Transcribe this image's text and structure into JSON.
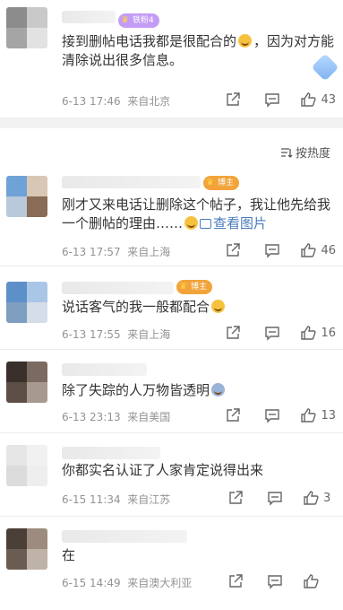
{
  "sort": {
    "label": "按热度"
  },
  "comments": [
    {
      "badge": "铁粉4",
      "text_a": "接到删帖电话我都是很配合的",
      "text_b": "，因为对方能清除说出很多信息。",
      "time": "6-13 17:46",
      "location": "来自北京",
      "likes": "43"
    },
    {
      "badge": "博主",
      "text_a": "刚才又来电话让删除这个帖子，我让他先给我一个删帖的理由……",
      "link": "查看图片",
      "time": "6-13 17:57",
      "location": "来自上海",
      "likes": "46"
    },
    {
      "badge": "博主",
      "text_a": "说话客气的我一般都配合",
      "time": "6-13 17:55",
      "location": "来自上海",
      "likes": "16"
    },
    {
      "text_a": "除了失踪的人万物皆透明",
      "time": "6-13 23:13",
      "location": "来自美国",
      "likes": "13"
    },
    {
      "text_a": "你都实名认证了人家肯定说得出来",
      "time": "6-15 11:34",
      "location": "来自江苏",
      "likes": "3"
    },
    {
      "text_a": "在",
      "time": "6-15 14:49",
      "location": "来自澳大利亚",
      "likes": ""
    }
  ],
  "colors": {
    "fan_badge": "#c39cf5",
    "host_badge": "#f2a33a",
    "link": "#4a7bbd",
    "meta": "#939393"
  },
  "icons": [
    "share-icon",
    "comment-icon",
    "like-icon",
    "sort-icon",
    "view-image-icon"
  ]
}
